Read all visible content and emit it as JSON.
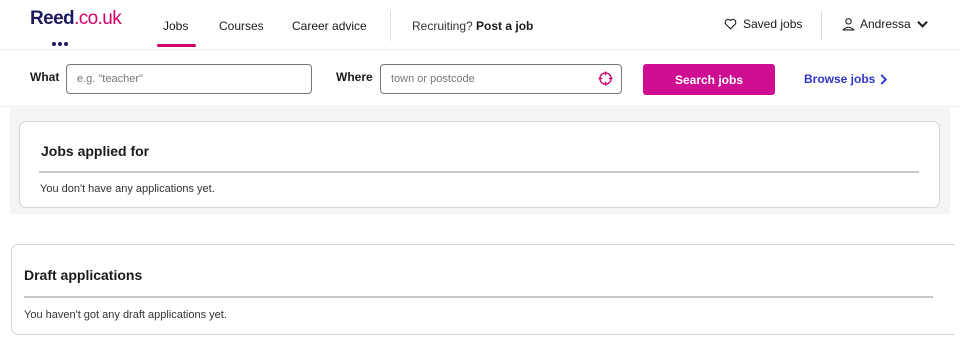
{
  "header": {
    "logo": {
      "main": "Reed",
      "suffix": ".co.uk"
    },
    "nav": [
      {
        "label": "Jobs",
        "active": true
      },
      {
        "label": "Courses",
        "active": false
      },
      {
        "label": "Career advice",
        "active": false
      }
    ],
    "recruiting_prefix": "Recruiting?",
    "post_job_label": "Post a job",
    "saved_jobs_label": "Saved jobs",
    "user_name": "Andressa"
  },
  "search": {
    "what_label": "What",
    "what_placeholder": "e.g. \"teacher\"",
    "what_value": "",
    "where_label": "Where",
    "where_placeholder": "town or postcode",
    "where_value": "",
    "search_button": "Search jobs",
    "browse_link": "Browse jobs"
  },
  "sections": {
    "applied": {
      "title": "Jobs applied for",
      "empty_text": "You don't have any applications yet."
    },
    "drafts": {
      "title": "Draft applications",
      "empty_text": "You haven't got any draft applications yet."
    }
  },
  "icons": {
    "saved": "heart-icon",
    "user": "user-icon",
    "dropdown": "chevron-down-icon",
    "location": "crosshair-icon",
    "browse": "chevron-right-icon"
  },
  "colors": {
    "brand_navy": "#1b1b5e",
    "brand_pink": "#d1006b",
    "button_magenta": "#cf0d93",
    "link_blue": "#2e36c9"
  }
}
